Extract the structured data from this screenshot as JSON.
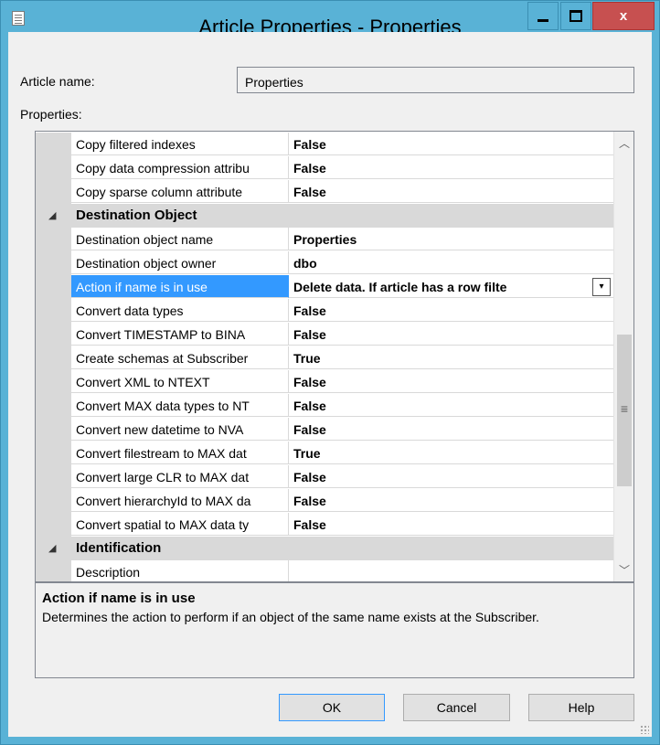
{
  "window": {
    "title": "Article Properties - Properties",
    "close_glyph": "x",
    "app_icon": "properties-window-icon"
  },
  "form": {
    "article_name_label": "Article name:",
    "article_name_value": "Properties",
    "properties_label": "Properties:"
  },
  "grid": {
    "rows": [
      {
        "type": "property",
        "name": "Copy filtered indexes",
        "value": "False"
      },
      {
        "type": "property",
        "name": "Copy data compression attribu",
        "value": "False"
      },
      {
        "type": "property",
        "name": "Copy sparse column attribute",
        "value": "False"
      },
      {
        "type": "category",
        "name": "Destination Object",
        "expander": "◢"
      },
      {
        "type": "property",
        "name": "Destination object name",
        "value": "Properties"
      },
      {
        "type": "property",
        "name": "Destination object owner",
        "value": "dbo"
      },
      {
        "type": "property",
        "name": "Action if name is in use",
        "value": "Delete data. If article has a row filte",
        "selected": true,
        "dropdown": "▾"
      },
      {
        "type": "property",
        "name": "Convert data types",
        "value": "False"
      },
      {
        "type": "property",
        "name": "Convert TIMESTAMP to BINA",
        "value": "False"
      },
      {
        "type": "property",
        "name": "Create schemas at Subscriber",
        "value": "True"
      },
      {
        "type": "property",
        "name": "Convert XML to NTEXT",
        "value": "False"
      },
      {
        "type": "property",
        "name": "Convert MAX data types to NT",
        "value": "False"
      },
      {
        "type": "property",
        "name": "Convert new datetime to NVA",
        "value": "False"
      },
      {
        "type": "property",
        "name": "Convert filestream to MAX dat",
        "value": "True"
      },
      {
        "type": "property",
        "name": "Convert large CLR to MAX dat",
        "value": "False"
      },
      {
        "type": "property",
        "name": "Convert hierarchyId to MAX da",
        "value": "False"
      },
      {
        "type": "property",
        "name": "Convert spatial to MAX data ty",
        "value": "False"
      },
      {
        "type": "category",
        "name": "Identification",
        "expander": "◢"
      },
      {
        "type": "property",
        "name": "Description",
        "value": ""
      }
    ],
    "scroll": {
      "up": "︿",
      "down": "﹀",
      "grip": "≡"
    }
  },
  "description": {
    "title": "Action if name is in use",
    "text": "Determines the action to perform if an object of the same name exists at the Subscriber."
  },
  "buttons": {
    "ok": "OK",
    "cancel": "Cancel",
    "help": "Help"
  },
  "colors": {
    "title_bar": "#59b2d6",
    "close_button": "#c75050",
    "selection": "#3399ff",
    "category_band": "#d9d9d9"
  }
}
